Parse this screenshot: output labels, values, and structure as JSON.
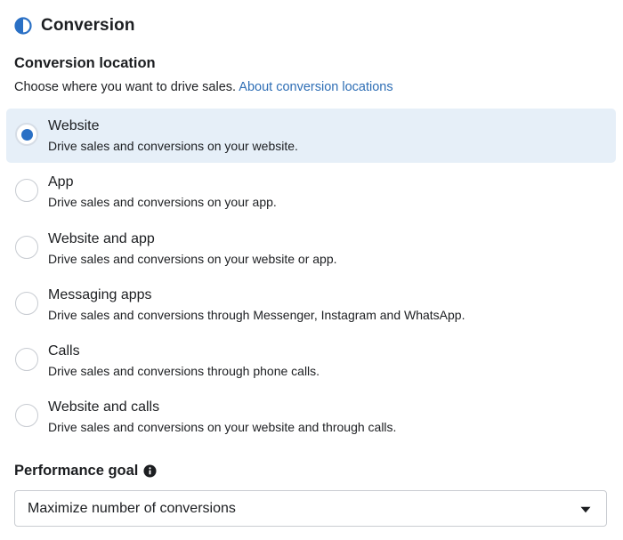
{
  "section": {
    "icon": "half-circle-icon",
    "title": "Conversion"
  },
  "conversion_location": {
    "title": "Conversion location",
    "description": "Choose where you want to drive sales.",
    "link_text": "About conversion locations",
    "selected_index": 0,
    "options": [
      {
        "label": "Website",
        "description": "Drive sales and conversions on your website."
      },
      {
        "label": "App",
        "description": "Drive sales and conversions on your app."
      },
      {
        "label": "Website and app",
        "description": "Drive sales and conversions on your website or app."
      },
      {
        "label": "Messaging apps",
        "description": "Drive sales and conversions through Messenger, Instagram and WhatsApp."
      },
      {
        "label": "Calls",
        "description": "Drive sales and conversions through phone calls."
      },
      {
        "label": "Website and calls",
        "description": "Drive sales and conversions on your website and through calls."
      }
    ]
  },
  "performance_goal": {
    "title": "Performance goal",
    "info_icon": "info-icon",
    "selected_value": "Maximize number of conversions",
    "caret_icon": "caret-down-icon"
  },
  "colors": {
    "accent": "#2a70c5",
    "link": "#2e6eb5",
    "selected_bg": "#e6eff8",
    "text": "#1c1e21"
  }
}
